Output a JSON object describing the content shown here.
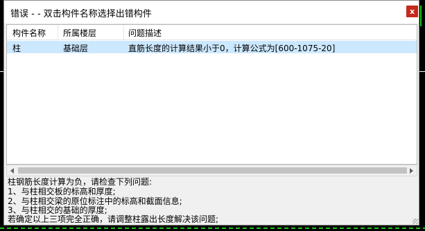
{
  "window": {
    "title": "错误 - - 双击构件名称选择出错构件",
    "close_glyph": "x"
  },
  "table": {
    "columns": [
      "构件名称",
      "所属楼层",
      "问题描述"
    ],
    "rows": [
      {
        "name": "柱",
        "floor": "基础层",
        "description": "直筋长度的计算结果小于0，计算公式为[600-1075-20]",
        "selected": true
      }
    ]
  },
  "details": {
    "lines": [
      "柱钢筋长度计算为负，请检查下列问题:",
      " 1、与柱相交板的标高和厚度;",
      " 2、与柱相交梁的原位标注中的标高和截面信息;",
      " 3、与柱相交的基础的厚度;",
      "若确定以上三项完全正确，请调整柱露出长度解决该问题;"
    ]
  },
  "colors": {
    "selection": "#cce8ff",
    "close_button": "#c42b1c",
    "background": "#000000",
    "cad_green": "#22c41c"
  }
}
